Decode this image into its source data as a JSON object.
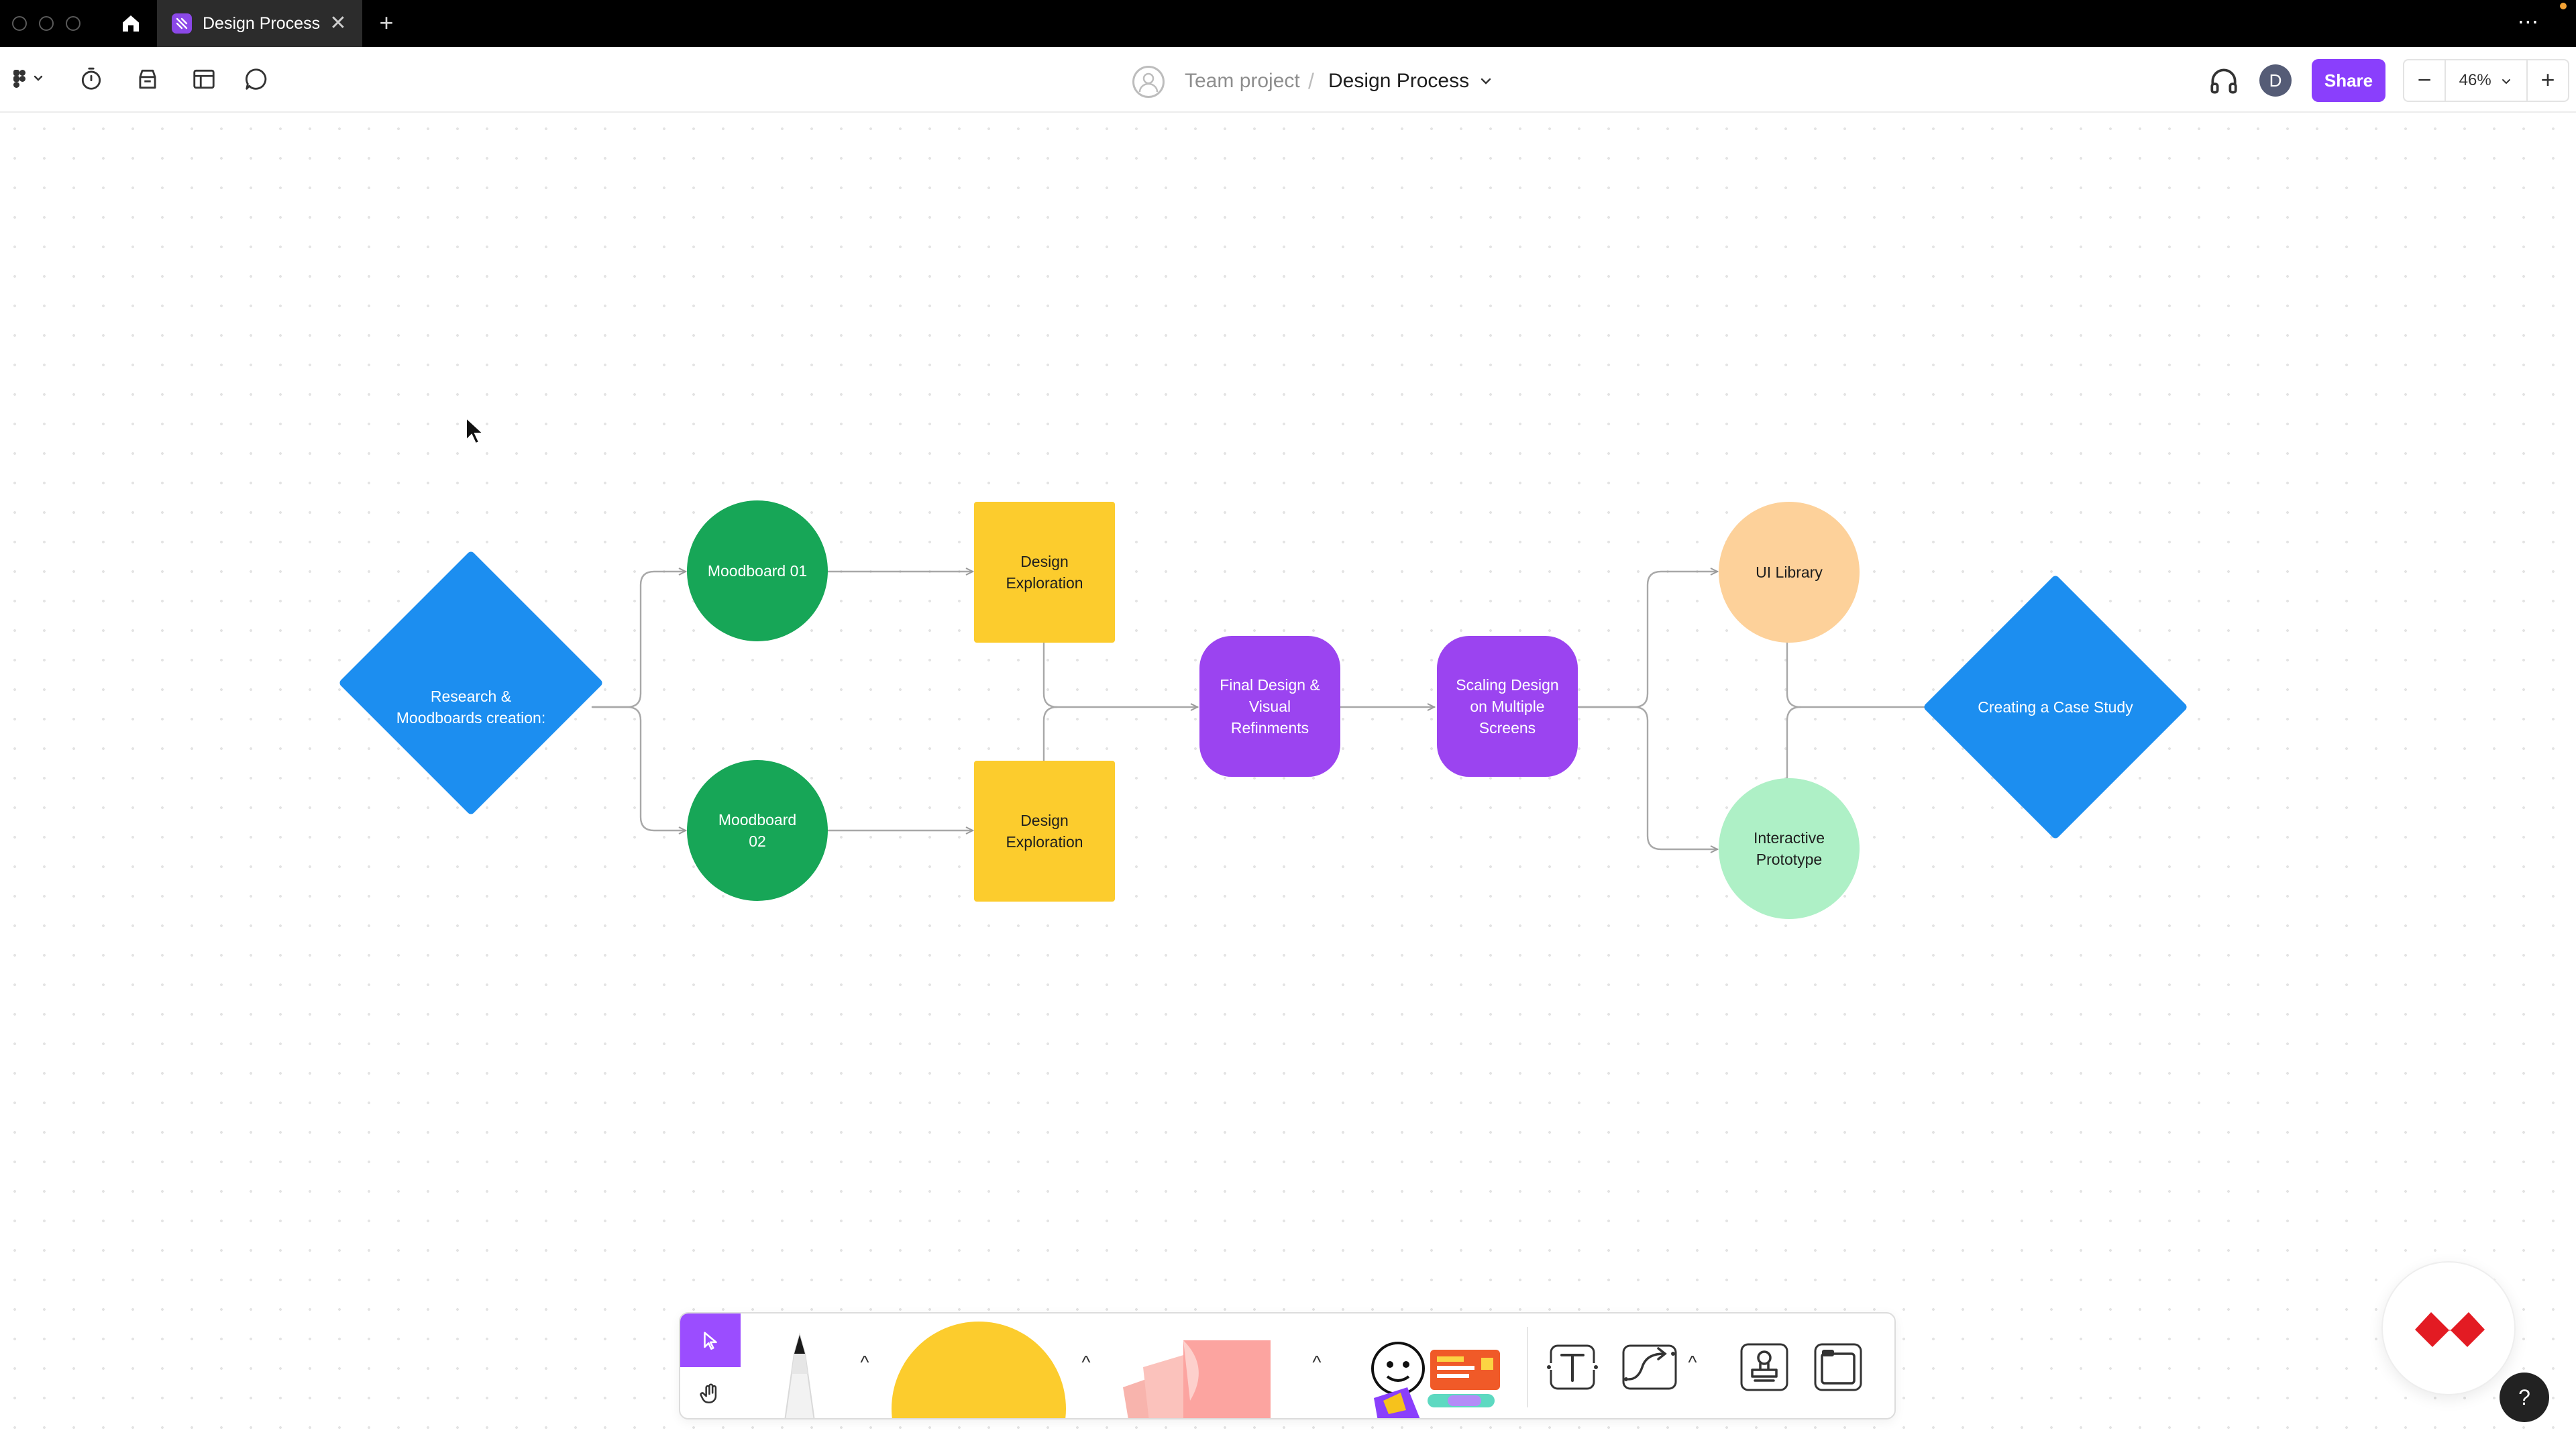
{
  "titlebar": {
    "tab_title": "Design Process",
    "tab_close": "✕",
    "new_tab": "+",
    "more": "⋯",
    "tab_color": "#8b48e8"
  },
  "toolbar": {
    "breadcrumb_team": "Team project",
    "breadcrumb_separator": "/",
    "breadcrumb_file": "Design Process",
    "user_initial": "D",
    "share_label": "Share",
    "zoom_minus": "−",
    "zoom_level": "46%",
    "zoom_plus": "+",
    "accent": "#8a3ffc"
  },
  "diagram": {
    "nodes": [
      {
        "id": "research",
        "shape": "diamond",
        "lines": [
          "Research &",
          "Moodboards",
          "creation:"
        ],
        "color": "#1c8ef0"
      },
      {
        "id": "moodboard1",
        "shape": "circle",
        "lines": [
          "Moodboard 01"
        ],
        "color": "#17a657"
      },
      {
        "id": "moodboard2",
        "shape": "circle",
        "lines": [
          "Moodboard",
          "02"
        ],
        "color": "#17a657"
      },
      {
        "id": "explore1",
        "shape": "square",
        "lines": [
          "Design",
          "Exploration"
        ],
        "color": "#fccc2d"
      },
      {
        "id": "explore2",
        "shape": "square",
        "lines": [
          "Design",
          "Exploration"
        ],
        "color": "#fccc2d"
      },
      {
        "id": "final",
        "shape": "rounded",
        "lines": [
          "Final Design &",
          "Visual",
          "Refinments"
        ],
        "color": "#9b44f0"
      },
      {
        "id": "scaling",
        "shape": "rounded",
        "lines": [
          "Scaling Design",
          "on Multiple",
          "Screens"
        ],
        "color": "#9b44f0"
      },
      {
        "id": "uilibrary",
        "shape": "circle",
        "lines": [
          "UI Library"
        ],
        "color": "#fdd19a"
      },
      {
        "id": "prototype",
        "shape": "circle",
        "lines": [
          "Interactive",
          "Prototype"
        ],
        "color": "#aef0c6"
      },
      {
        "id": "casestudy",
        "shape": "diamond",
        "lines": [
          "Creating a Case",
          "Study"
        ],
        "color": "#1c8ef0"
      }
    ]
  },
  "dock": {
    "select_icon": "cursor-arrow-icon",
    "hand_icon": "hand-icon",
    "text_tool": "T",
    "caret": "^",
    "sticky_color": "#fca4a0",
    "shape_color": "#fccc2d",
    "select_color": "#9b4dff"
  },
  "help": {
    "label": "?"
  }
}
